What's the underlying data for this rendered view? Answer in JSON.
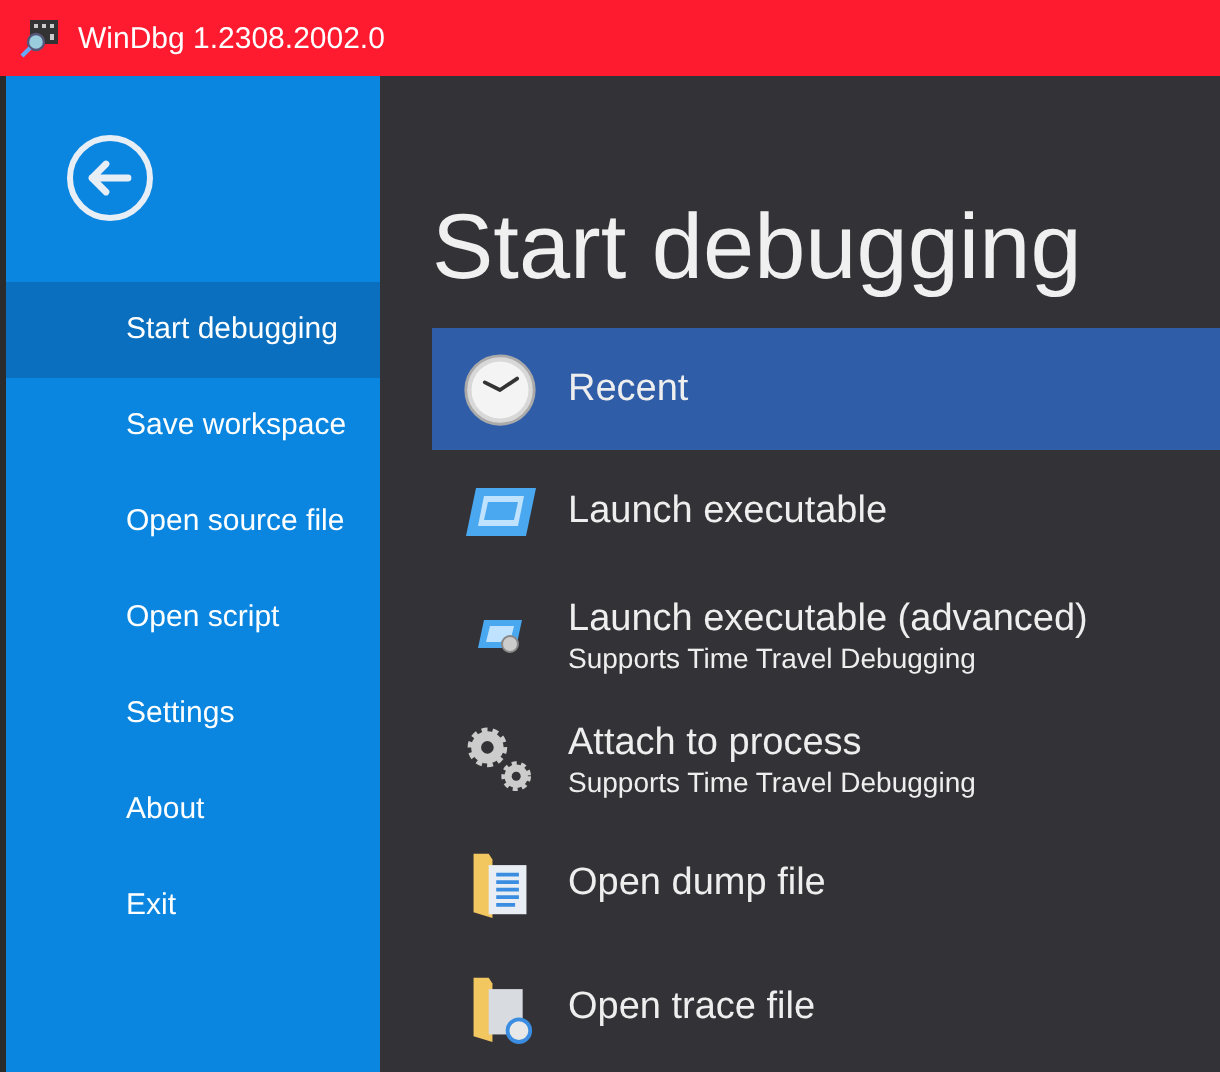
{
  "window": {
    "title": "WinDbg 1.2308.2002.0"
  },
  "sidebar": {
    "items": [
      {
        "label": "Start debugging",
        "selected": true
      },
      {
        "label": "Save workspace",
        "selected": false
      },
      {
        "label": "Open source file",
        "selected": false
      },
      {
        "label": "Open script",
        "selected": false
      },
      {
        "label": "Settings",
        "selected": false
      },
      {
        "label": "About",
        "selected": false
      },
      {
        "label": "Exit",
        "selected": false
      }
    ]
  },
  "main": {
    "heading": "Start debugging",
    "items": [
      {
        "kind": "clock",
        "label": "Recent",
        "selected": true
      },
      {
        "kind": "launch",
        "label": "Launch executable",
        "selected": false
      },
      {
        "kind": "launch-advanced",
        "label": "Launch executable (advanced)",
        "subtitle": "Supports Time Travel Debugging",
        "selected": false
      },
      {
        "kind": "gears",
        "label": "Attach to process",
        "subtitle": "Supports Time Travel Debugging",
        "selected": false
      },
      {
        "kind": "dump",
        "label": "Open dump file",
        "selected": false
      },
      {
        "kind": "trace",
        "label": "Open trace file",
        "selected": false
      }
    ]
  }
}
